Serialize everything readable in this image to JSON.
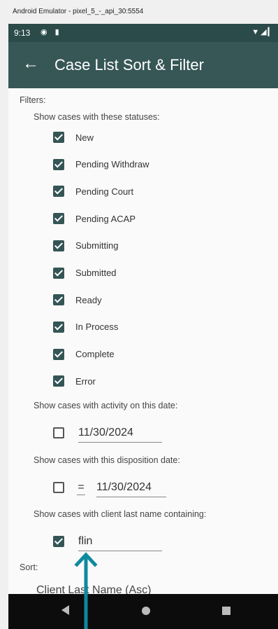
{
  "emulator_title": "Android Emulator - pixel_5_-_api_30:5554",
  "statusbar": {
    "time": "9:13",
    "icons_left": "◉ ▮",
    "icons_right": "▼◢▎"
  },
  "appbar": {
    "back_icon": "←",
    "title": "Case List Sort & Filter"
  },
  "filters": {
    "heading": "Filters:",
    "status_prompt": "Show cases with these statuses:",
    "statuses": [
      {
        "label": "New",
        "checked": true
      },
      {
        "label": "Pending Withdraw",
        "checked": true
      },
      {
        "label": "Pending Court",
        "checked": true
      },
      {
        "label": "Pending ACAP",
        "checked": true
      },
      {
        "label": "Submitting",
        "checked": true
      },
      {
        "label": "Submitted",
        "checked": true
      },
      {
        "label": "Ready",
        "checked": true
      },
      {
        "label": "In Process",
        "checked": true
      },
      {
        "label": "Complete",
        "checked": true
      },
      {
        "label": "Error",
        "checked": true
      }
    ],
    "activity_prompt": "Show cases with activity on this date:",
    "activity": {
      "checked": false,
      "date": "11/30/2024"
    },
    "disposition_prompt": "Show cases with this disposition date:",
    "disposition": {
      "checked": false,
      "operator": "=",
      "date": "11/30/2024"
    },
    "lastname_prompt": "Show cases with client last name containing:",
    "lastname": {
      "checked": true,
      "value": "flin"
    }
  },
  "sort": {
    "heading": "Sort:",
    "value": "Client Last Name (Asc)"
  },
  "colors": {
    "appbar": "#375656",
    "statusbar": "#2b4a4a",
    "arrow": "#0e8a9e",
    "checkbox": "#355555"
  }
}
